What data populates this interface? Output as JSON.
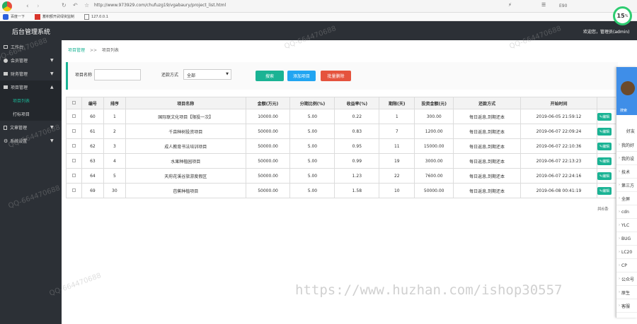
{
  "browser": {
    "url": "http://www.973929.com/chufuzg19/vgabaury/project_list.html",
    "speed": "15",
    "speed_unit": "%",
    "ext_label": "E90"
  },
  "bookmarks": [
    {
      "label": "百度一下"
    },
    {
      "label": "蓄积额开武绿资监制"
    },
    {
      "label": "127.0.0.1"
    }
  ],
  "header": {
    "title": "后台管理系统",
    "user": "欢迎您，管理员(admin)"
  },
  "sidebar": {
    "items": [
      {
        "label": "工作台"
      },
      {
        "label": "会员管理"
      },
      {
        "label": "财务管理"
      },
      {
        "label": "项目管理"
      },
      {
        "label": "项目列表",
        "sub": true,
        "active": true
      },
      {
        "label": "打标项目",
        "sub": true
      },
      {
        "label": "文章管理"
      },
      {
        "label": "系统设置"
      }
    ]
  },
  "breadcrumb": {
    "root": "项目管理",
    "sep": ">>",
    "current": "项目列表"
  },
  "filters": {
    "name_label": "项目名称",
    "name_value": "",
    "type_label": "还款方式",
    "type_value": "全部"
  },
  "actions": {
    "search": "搜索",
    "add": "添加项目",
    "batch_delete": "批量删除"
  },
  "colors": {
    "teal": "#1ab394",
    "blue": "#22a5f1",
    "red": "#e5533d",
    "dark": "#2c3036"
  },
  "table": {
    "headers": [
      "编号",
      "排序",
      "项目名称",
      "金额(万元)",
      "分期比例(%)",
      "收益率(%)",
      "期限(天)",
      "投资金额(元)",
      "还款方式",
      "开始时间"
    ],
    "rows": [
      {
        "id": "60",
        "sort": "1",
        "name": "国际联文化项目【限投一次】",
        "amount": "10000.00",
        "ratio": "5.00",
        "rate": "0.22",
        "days": "1",
        "invest": "300.00",
        "repay": "每日返息,到期还本",
        "time": "2019-06-05 21:59:12"
      },
      {
        "id": "61",
        "sort": "2",
        "name": "千亩种树投资项目",
        "amount": "50000.00",
        "ratio": "5.00",
        "rate": "0.83",
        "days": "7",
        "invest": "1200.00",
        "repay": "每日返息,到期还本",
        "time": "2019-06-07 22:09:24"
      },
      {
        "id": "62",
        "sort": "3",
        "name": "成人教育书法培训项目",
        "amount": "50000.00",
        "ratio": "5.00",
        "rate": "0.95",
        "days": "11",
        "invest": "15000.00",
        "repay": "每日返息,到期还本",
        "time": "2019-06-07 22:10:36"
      },
      {
        "id": "63",
        "sort": "4",
        "name": "水果种植园项目",
        "amount": "50000.00",
        "ratio": "5.00",
        "rate": "0.99",
        "days": "19",
        "invest": "3000.00",
        "repay": "每日返息,到期还本",
        "time": "2019-06-07 22:13:23"
      },
      {
        "id": "64",
        "sort": "5",
        "name": "天府花溪谷旅游度假区",
        "amount": "50000.00",
        "ratio": "5.00",
        "rate": "1.23",
        "days": "22",
        "invest": "7600.00",
        "repay": "每日返息,到期还本",
        "time": "2019-06-07 22:24:16"
      },
      {
        "id": "69",
        "sort": "30",
        "name": "芭蕉种植项目",
        "amount": "50000.00",
        "ratio": "5.00",
        "rate": "1.58",
        "days": "10",
        "invest": "50000.00",
        "repay": "每日返息,到期还本",
        "time": "2019-06-08 00:41:19"
      }
    ],
    "edit_label": "编辑"
  },
  "pager": {
    "text": "共6条"
  },
  "right_panel": {
    "search": "搜索",
    "tab": "好友",
    "items": [
      "我的好",
      "我的设",
      "技术",
      "第三方",
      "全屏",
      "cdn",
      "YLC",
      "BUG",
      "LC20",
      "CP",
      "公众号",
      "原生",
      "客服"
    ]
  },
  "watermarks": [
    "QQ-664470688",
    "https://www.huzhan.com/ishop30557"
  ]
}
